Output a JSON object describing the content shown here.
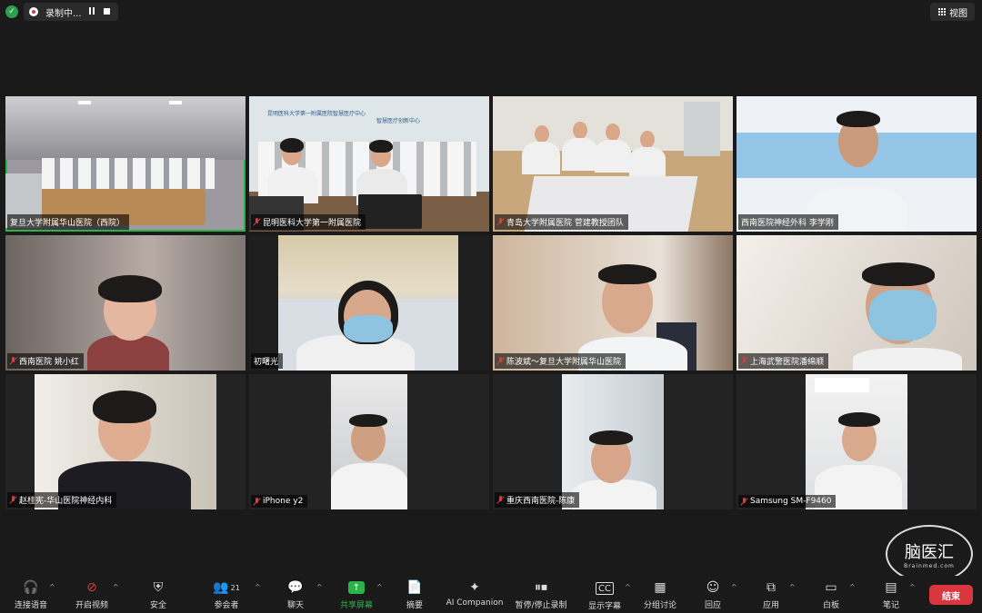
{
  "topbar": {
    "recording_label": "录制中...",
    "view_label": "视图"
  },
  "tiles": [
    {
      "name": "复旦大学附属华山医院（西院）",
      "muted": false,
      "active": true
    },
    {
      "name": "昆明医科大学第一附属医院",
      "muted": true,
      "active": false,
      "banner_line1": "昆明医科大学第一附属医院智慧医疗中心",
      "banner_line2": "智慧医疗创新中心"
    },
    {
      "name": "青岛大学附属医院 菅建教授团队",
      "muted": true,
      "active": false
    },
    {
      "name": "西南医院神经外科 李学刚",
      "muted": false,
      "active": false
    },
    {
      "name": "西南医院 姚小红",
      "muted": true,
      "active": false
    },
    {
      "name": "初曙光",
      "muted": false,
      "active": false
    },
    {
      "name": "陈波斌～复旦大学附属华山医院",
      "muted": true,
      "active": false
    },
    {
      "name": "上海武警医院潘绵顺",
      "muted": true,
      "active": false
    },
    {
      "name": "赵桂宪-华山医院神经内科",
      "muted": true,
      "active": false
    },
    {
      "name": "iPhone y2",
      "muted": true,
      "active": false
    },
    {
      "name": "重庆西南医院-陈康",
      "muted": true,
      "active": false
    },
    {
      "name": "Samsung SM-F9460",
      "muted": true,
      "active": false
    }
  ],
  "toolbar": {
    "audio": "连接语音",
    "video": "开启视频",
    "security": "安全",
    "participants": "参会者",
    "participants_count": "21",
    "chat": "聊天",
    "share": "共享屏幕",
    "summary": "摘要",
    "ai": "AI Companion",
    "record": "暂停/停止录制",
    "captions": "显示字幕",
    "breakout": "分组讨论",
    "react": "回应",
    "apps": "应用",
    "whiteboard": "白板",
    "notes": "笔记",
    "end": "结束"
  },
  "watermark": {
    "main": "脑医汇",
    "sub": "Brainmed.com"
  },
  "colors": {
    "active_border": "#2bb34a",
    "end_button": "#d9363e",
    "muted_icon": "#e0383e"
  }
}
